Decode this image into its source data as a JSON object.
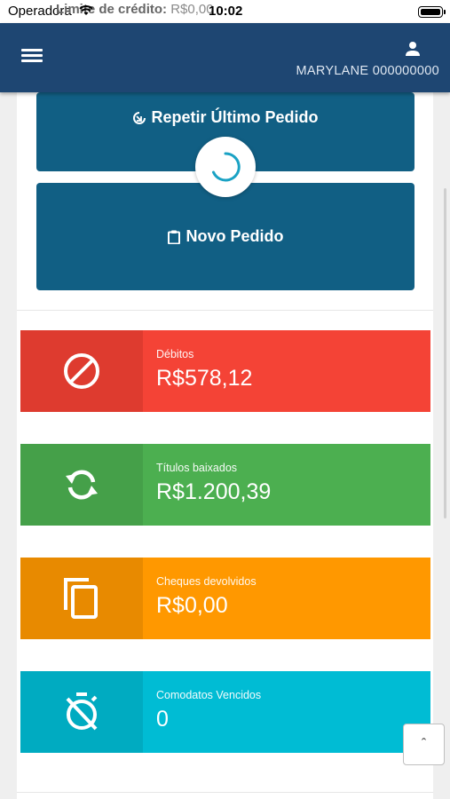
{
  "status_bar": {
    "carrier": "Operadora",
    "credit_label": "Limite de crédito:",
    "credit_value": "R$0,00",
    "time": "10:02"
  },
  "header": {
    "menu_icon": "hamburger-menu-icon",
    "user_icon": "person-icon",
    "user_name": "MARYLANE 000000000"
  },
  "actions": {
    "repeat_label": "Repetir Último Pedido",
    "repeat_icon": "repeat-order-icon",
    "new_label": "Novo Pedido",
    "new_icon": "clipboard-icon"
  },
  "stats": [
    {
      "label": "Débitos",
      "value": "R$578,12",
      "icon": "block-icon",
      "color": "#f44336",
      "dark_color": "#de3b2f"
    },
    {
      "label": "Títulos baixados",
      "value": "R$1.200,39",
      "icon": "sync-icon",
      "color": "#4caf50",
      "dark_color": "#45a049"
    },
    {
      "label": "Cheques devolvidos",
      "value": "R$0,00",
      "icon": "copy-icon",
      "color": "#ff9800",
      "dark_color": "#e88a00"
    },
    {
      "label": "Comodatos Vencidos",
      "value": "0",
      "icon": "timer-off-icon",
      "color": "#00bcd4",
      "dark_color": "#00abc1"
    }
  ],
  "scroll_top": {
    "label": "ˆ",
    "icon": "chevron-up-icon"
  },
  "colors": {
    "header": "#1e4672",
    "action_button": "#115f84"
  }
}
